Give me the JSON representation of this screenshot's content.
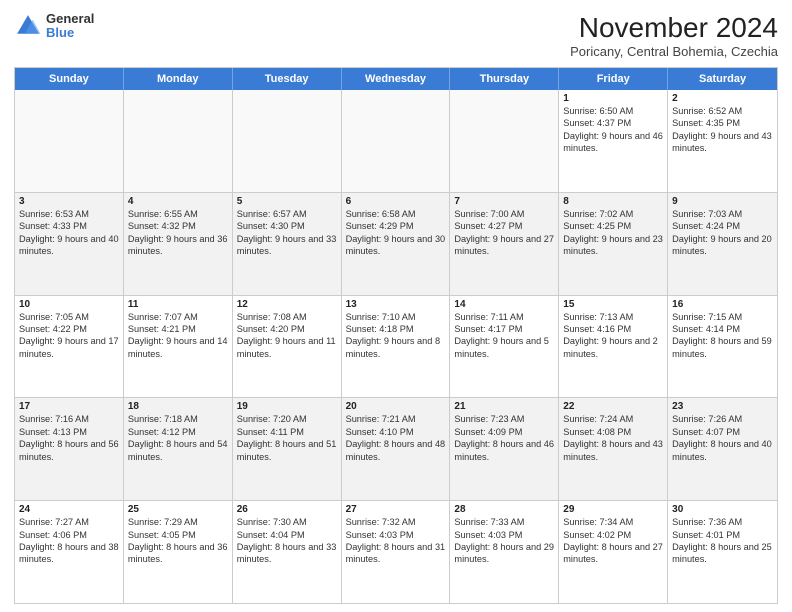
{
  "logo": {
    "general": "General",
    "blue": "Blue",
    "icon_color": "#3a7bd5"
  },
  "header": {
    "month_title": "November 2024",
    "location": "Poricany, Central Bohemia, Czechia"
  },
  "weekdays": [
    "Sunday",
    "Monday",
    "Tuesday",
    "Wednesday",
    "Thursday",
    "Friday",
    "Saturday"
  ],
  "rows": [
    {
      "alt": false,
      "cells": [
        {
          "day": "",
          "info": ""
        },
        {
          "day": "",
          "info": ""
        },
        {
          "day": "",
          "info": ""
        },
        {
          "day": "",
          "info": ""
        },
        {
          "day": "",
          "info": ""
        },
        {
          "day": "1",
          "info": "Sunrise: 6:50 AM\nSunset: 4:37 PM\nDaylight: 9 hours and 46 minutes."
        },
        {
          "day": "2",
          "info": "Sunrise: 6:52 AM\nSunset: 4:35 PM\nDaylight: 9 hours and 43 minutes."
        }
      ]
    },
    {
      "alt": true,
      "cells": [
        {
          "day": "3",
          "info": "Sunrise: 6:53 AM\nSunset: 4:33 PM\nDaylight: 9 hours and 40 minutes."
        },
        {
          "day": "4",
          "info": "Sunrise: 6:55 AM\nSunset: 4:32 PM\nDaylight: 9 hours and 36 minutes."
        },
        {
          "day": "5",
          "info": "Sunrise: 6:57 AM\nSunset: 4:30 PM\nDaylight: 9 hours and 33 minutes."
        },
        {
          "day": "6",
          "info": "Sunrise: 6:58 AM\nSunset: 4:29 PM\nDaylight: 9 hours and 30 minutes."
        },
        {
          "day": "7",
          "info": "Sunrise: 7:00 AM\nSunset: 4:27 PM\nDaylight: 9 hours and 27 minutes."
        },
        {
          "day": "8",
          "info": "Sunrise: 7:02 AM\nSunset: 4:25 PM\nDaylight: 9 hours and 23 minutes."
        },
        {
          "day": "9",
          "info": "Sunrise: 7:03 AM\nSunset: 4:24 PM\nDaylight: 9 hours and 20 minutes."
        }
      ]
    },
    {
      "alt": false,
      "cells": [
        {
          "day": "10",
          "info": "Sunrise: 7:05 AM\nSunset: 4:22 PM\nDaylight: 9 hours and 17 minutes."
        },
        {
          "day": "11",
          "info": "Sunrise: 7:07 AM\nSunset: 4:21 PM\nDaylight: 9 hours and 14 minutes."
        },
        {
          "day": "12",
          "info": "Sunrise: 7:08 AM\nSunset: 4:20 PM\nDaylight: 9 hours and 11 minutes."
        },
        {
          "day": "13",
          "info": "Sunrise: 7:10 AM\nSunset: 4:18 PM\nDaylight: 9 hours and 8 minutes."
        },
        {
          "day": "14",
          "info": "Sunrise: 7:11 AM\nSunset: 4:17 PM\nDaylight: 9 hours and 5 minutes."
        },
        {
          "day": "15",
          "info": "Sunrise: 7:13 AM\nSunset: 4:16 PM\nDaylight: 9 hours and 2 minutes."
        },
        {
          "day": "16",
          "info": "Sunrise: 7:15 AM\nSunset: 4:14 PM\nDaylight: 8 hours and 59 minutes."
        }
      ]
    },
    {
      "alt": true,
      "cells": [
        {
          "day": "17",
          "info": "Sunrise: 7:16 AM\nSunset: 4:13 PM\nDaylight: 8 hours and 56 minutes."
        },
        {
          "day": "18",
          "info": "Sunrise: 7:18 AM\nSunset: 4:12 PM\nDaylight: 8 hours and 54 minutes."
        },
        {
          "day": "19",
          "info": "Sunrise: 7:20 AM\nSunset: 4:11 PM\nDaylight: 8 hours and 51 minutes."
        },
        {
          "day": "20",
          "info": "Sunrise: 7:21 AM\nSunset: 4:10 PM\nDaylight: 8 hours and 48 minutes."
        },
        {
          "day": "21",
          "info": "Sunrise: 7:23 AM\nSunset: 4:09 PM\nDaylight: 8 hours and 46 minutes."
        },
        {
          "day": "22",
          "info": "Sunrise: 7:24 AM\nSunset: 4:08 PM\nDaylight: 8 hours and 43 minutes."
        },
        {
          "day": "23",
          "info": "Sunrise: 7:26 AM\nSunset: 4:07 PM\nDaylight: 8 hours and 40 minutes."
        }
      ]
    },
    {
      "alt": false,
      "cells": [
        {
          "day": "24",
          "info": "Sunrise: 7:27 AM\nSunset: 4:06 PM\nDaylight: 8 hours and 38 minutes."
        },
        {
          "day": "25",
          "info": "Sunrise: 7:29 AM\nSunset: 4:05 PM\nDaylight: 8 hours and 36 minutes."
        },
        {
          "day": "26",
          "info": "Sunrise: 7:30 AM\nSunset: 4:04 PM\nDaylight: 8 hours and 33 minutes."
        },
        {
          "day": "27",
          "info": "Sunrise: 7:32 AM\nSunset: 4:03 PM\nDaylight: 8 hours and 31 minutes."
        },
        {
          "day": "28",
          "info": "Sunrise: 7:33 AM\nSunset: 4:03 PM\nDaylight: 8 hours and 29 minutes."
        },
        {
          "day": "29",
          "info": "Sunrise: 7:34 AM\nSunset: 4:02 PM\nDaylight: 8 hours and 27 minutes."
        },
        {
          "day": "30",
          "info": "Sunrise: 7:36 AM\nSunset: 4:01 PM\nDaylight: 8 hours and 25 minutes."
        }
      ]
    }
  ]
}
